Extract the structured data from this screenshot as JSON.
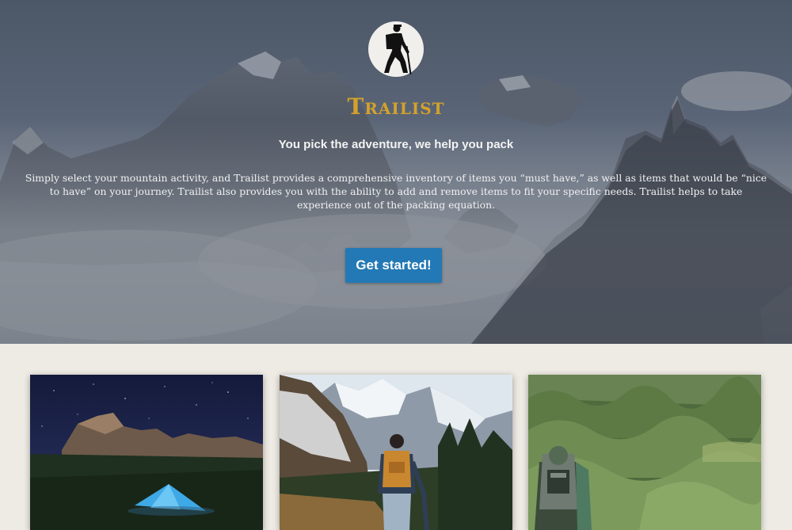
{
  "hero": {
    "brand": "Trailist",
    "tagline": "You pick the adventure, we help you pack",
    "description": "Simply select your mountain activity, and Trailist provides a comprehensive inventory of items you “must have,” as well as items that would be “nice to have” on your journey.  Trailist also provides you with the ability to add and remove items to fit your specific needs.  Trailist helps to take experience out of the packing equation.",
    "cta_label": "Get started!",
    "logo_icon": "hiker-icon"
  },
  "cards": [
    {
      "image": "night-camping-tent-image"
    },
    {
      "image": "hiker-snowy-mountains-image"
    },
    {
      "image": "backpacker-green-hills-image"
    }
  ],
  "colors": {
    "brand": "#d3a12c",
    "cta_background": "#2379b5",
    "page_background": "#eeebe4"
  }
}
